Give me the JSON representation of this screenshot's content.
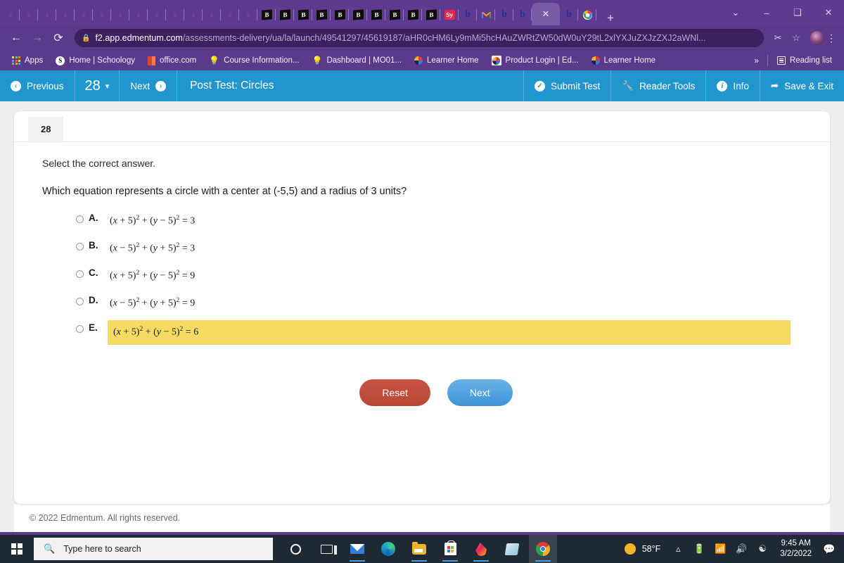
{
  "browser": {
    "tabs_bulb_count": 14,
    "tabs_b_count": 10,
    "tab_icons": [
      "sy-icon",
      "b-icon",
      "gmail-icon",
      "b-icon",
      "b-icon",
      "active-tab-close-icon",
      "b-icon",
      "google-icon"
    ],
    "sy_label": "Sy",
    "new_tab_label": "+",
    "window_controls": [
      "⌄",
      "–",
      "❐",
      "✕"
    ],
    "nav": {
      "back": "←",
      "forward": "→",
      "reload": "⟳"
    },
    "url": {
      "lock_icon": "🔒",
      "domain": "f2.app.edmentum.com",
      "path": "/assessments-delivery/ua/la/launch/49541297/45619187/aHR0cHM6Ly9mMi5hcHAuZWRtZW50dW0uY29tL2xlYXJuZXItdWItXu2RkWk...",
      "path_display": "/assessments-delivery/ua/la/launch/49541297/45619187/aHR0cHM6Ly9mMi5hcHAuZWRtZW50dW0uY29tL2xlYXJuZXJzZXJ2aWNl..."
    },
    "omnibox_icons": [
      "share-icon",
      "bookmark-star-icon"
    ],
    "profile": "avatar",
    "menu_icon": "kebab-menu-icon",
    "bookmarks": [
      {
        "label": "Apps",
        "icon": "apps-grid-icon"
      },
      {
        "label": "Home | Schoology",
        "icon": "schoology-icon"
      },
      {
        "label": "office.com",
        "icon": "office-icon"
      },
      {
        "label": "Course Information...",
        "icon": "bulb-icon"
      },
      {
        "label": "Dashboard | MO01...",
        "icon": "bulb-icon"
      },
      {
        "label": "Learner Home",
        "icon": "edmentum-icon"
      },
      {
        "label": "Product Login | Ed...",
        "icon": "edmentum-boxed-icon"
      },
      {
        "label": "Learner Home",
        "icon": "edmentum-icon"
      }
    ],
    "bookmarks_overflow": "»",
    "reading_list": "Reading list"
  },
  "apptoolbar": {
    "previous_label": "Previous",
    "previous_icon": "arrow-left-circle-icon",
    "question_number": "28",
    "question_dropdown_icon": "chevron-down-icon",
    "next_label": "Next",
    "next_icon": "arrow-right-circle-icon",
    "title": "Post Test: Circles",
    "submit_label": "Submit Test",
    "submit_icon": "check-circle-icon",
    "reader_tools_label": "Reader Tools",
    "reader_tools_icon": "wrench-icon",
    "info_label": "Info",
    "info_icon": "info-circle-icon",
    "save_exit_label": "Save & Exit",
    "save_exit_icon": "exit-arrow-icon"
  },
  "question": {
    "badge": "28",
    "instruction": "Select the correct answer.",
    "prompt": "Which equation represents a circle with a center at (-5,5) and a radius of 3 units?",
    "options": [
      {
        "letter": "A.",
        "text": "(x + 5)² + (y − 5)² = 3",
        "highlighted": false,
        "parts": [
          "(",
          "x",
          " + 5)",
          "2",
          " + (",
          "y",
          " − 5)",
          "2",
          " = 3"
        ]
      },
      {
        "letter": "B.",
        "text": "(x − 5)² + (y + 5)² = 3",
        "highlighted": false,
        "parts": [
          "(",
          "x",
          " − 5)",
          "2",
          " + (",
          "y",
          " + 5)",
          "2",
          " = 3"
        ]
      },
      {
        "letter": "C.",
        "text": "(x + 5)² + (y − 5)² = 9",
        "highlighted": false,
        "parts": [
          "(",
          "x",
          " + 5)",
          "2",
          " + (",
          "y",
          " − 5)",
          "2",
          " = 9"
        ]
      },
      {
        "letter": "D.",
        "text": "(x − 5)² + (y + 5)² = 9",
        "highlighted": false,
        "parts": [
          "(",
          "x",
          " − 5)",
          "2",
          " + (",
          "y",
          " + 5)",
          "2",
          " = 9"
        ]
      },
      {
        "letter": "E.",
        "text": "(x + 5)² + (y − 5)² = 6",
        "highlighted": true,
        "parts": [
          "(",
          "x",
          " + 5)",
          "2",
          " + (",
          "y",
          " − 5)",
          "2",
          " = 6"
        ]
      }
    ],
    "highlight_color": "#f5da63",
    "reset_label": "Reset",
    "next_label": "Next"
  },
  "footer": {
    "copyright": "© 2022 Edmentum. All rights reserved."
  },
  "taskbar": {
    "start_icon": "windows-start-icon",
    "search_placeholder": "Type here to search",
    "search_icon": "search-icon",
    "items": [
      "cortana-icon",
      "task-view-icon",
      "mail-icon",
      "edge-icon",
      "file-explorer-icon",
      "microsoft-store-icon",
      "paint3d-icon",
      "sticky-notes-icon",
      "chrome-icon"
    ],
    "temperature": "58°F",
    "weather_icon": "sun-icon",
    "tray_icons": [
      "chevron-up-icon",
      "battery-icon",
      "wifi-icon",
      "volume-icon",
      "bluetooth-icon"
    ],
    "time": "9:45 AM",
    "date": "3/2/2022",
    "action_center_icon": "speech-bubble-icon"
  }
}
